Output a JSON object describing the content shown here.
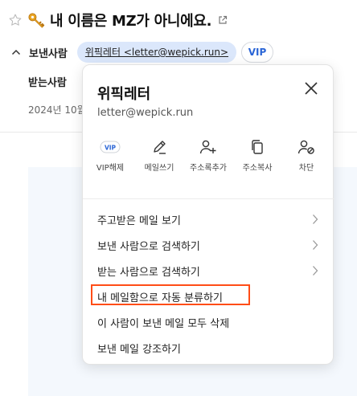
{
  "subject": {
    "title": "내 이름은 MZ가 아니에요.",
    "star_icon": "star-icon",
    "emoji_icon": "key-icon",
    "popout_icon": "open-new-window-icon"
  },
  "header": {
    "sender_label": "보낸사람",
    "sender_chip": "위픽레터 <letter@wepick.run>",
    "vip_badge": "VIP",
    "recipient_label": "받는사람",
    "date_text": "2024년 10월"
  },
  "popup": {
    "name": "위픽레터",
    "email": "letter@wepick.run",
    "actions": [
      {
        "icon": "vip-icon",
        "label": "VIP해제",
        "icon_text": "VIP"
      },
      {
        "icon": "pencil-icon",
        "label": "메일쓰기"
      },
      {
        "icon": "add-person-icon",
        "label": "주소록추가"
      },
      {
        "icon": "copy-icon",
        "label": "주소복사"
      },
      {
        "icon": "block-person-icon",
        "label": "차단"
      }
    ],
    "menu": [
      {
        "label": "주고받은 메일 보기",
        "arrow": true
      },
      {
        "label": "보낸 사람으로 검색하기",
        "arrow": true
      },
      {
        "label": "받는 사람으로 검색하기",
        "arrow": true
      },
      {
        "label": "내 메일함으로 자동 분류하기",
        "arrow": false,
        "highlighted": true
      },
      {
        "label": "이 사람이 보낸 메일 모두 삭제",
        "arrow": false
      },
      {
        "label": "보낸 메일 강조하기",
        "arrow": false
      }
    ]
  },
  "colors": {
    "chip_bg": "#dbe7fb",
    "vip_blue": "#2a65d6",
    "highlight_border": "#ff4d17",
    "mail_body_bg": "#f4f8fd"
  }
}
